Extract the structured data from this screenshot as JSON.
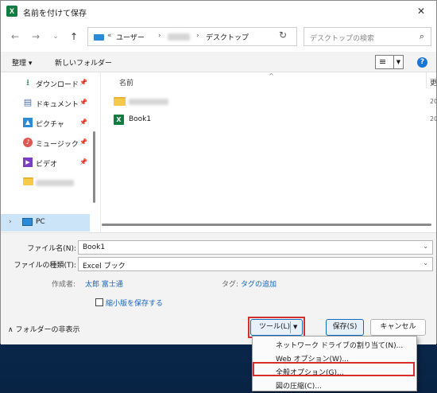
{
  "window": {
    "title": "名前を付けて保存",
    "app_icon_letter": "X"
  },
  "address": {
    "prefix": "«",
    "crumbs": [
      "ユーザー",
      "デスクトップ"
    ],
    "separator": "›"
  },
  "search": {
    "placeholder": "デスクトップの検索"
  },
  "toolbar": {
    "organize": "整理 ▾",
    "new_folder": "新しいフォルダー",
    "help": "?"
  },
  "sidebar": {
    "items": [
      {
        "label": "ダウンロード",
        "icon": "download-icon"
      },
      {
        "label": "ドキュメント",
        "icon": "document-icon"
      },
      {
        "label": "ピクチャ",
        "icon": "picture-icon"
      },
      {
        "label": "ミュージック",
        "icon": "music-icon"
      },
      {
        "label": "ビデオ",
        "icon": "video-icon"
      }
    ],
    "pc_label": "PC"
  },
  "files": {
    "column_name": "名前",
    "column_date_partial": "更",
    "rows": [
      {
        "name": "",
        "type": "folder",
        "date_partial": "20"
      },
      {
        "name": "Book1",
        "type": "excel",
        "date_partial": "20"
      }
    ]
  },
  "form": {
    "filename_label": "ファイル名(N):",
    "filename_value": "Book1",
    "filetype_label": "ファイルの種類(T):",
    "filetype_value": "Excel ブック",
    "author_label": "作成者:",
    "author_value": "太郎 富士通",
    "tags_label": "タグ:",
    "tags_value": "タグの追加",
    "thumbnail_label": "縮小版を保存する",
    "hide_folders": "フォルダーの非表示"
  },
  "buttons": {
    "tools": "ツール(L)",
    "save": "保存(S)",
    "cancel": "キャンセル"
  },
  "tools_menu": {
    "items": [
      "ネットワーク ドライブの割り当て(N)...",
      "Web オプション(W)...",
      "全般オプション(G)...",
      "図の圧縮(C)..."
    ],
    "highlighted_index": 2
  },
  "colors": {
    "highlight_box": "#d32f2f",
    "accent": "#0f6cbd",
    "excel_green": "#107c41"
  }
}
